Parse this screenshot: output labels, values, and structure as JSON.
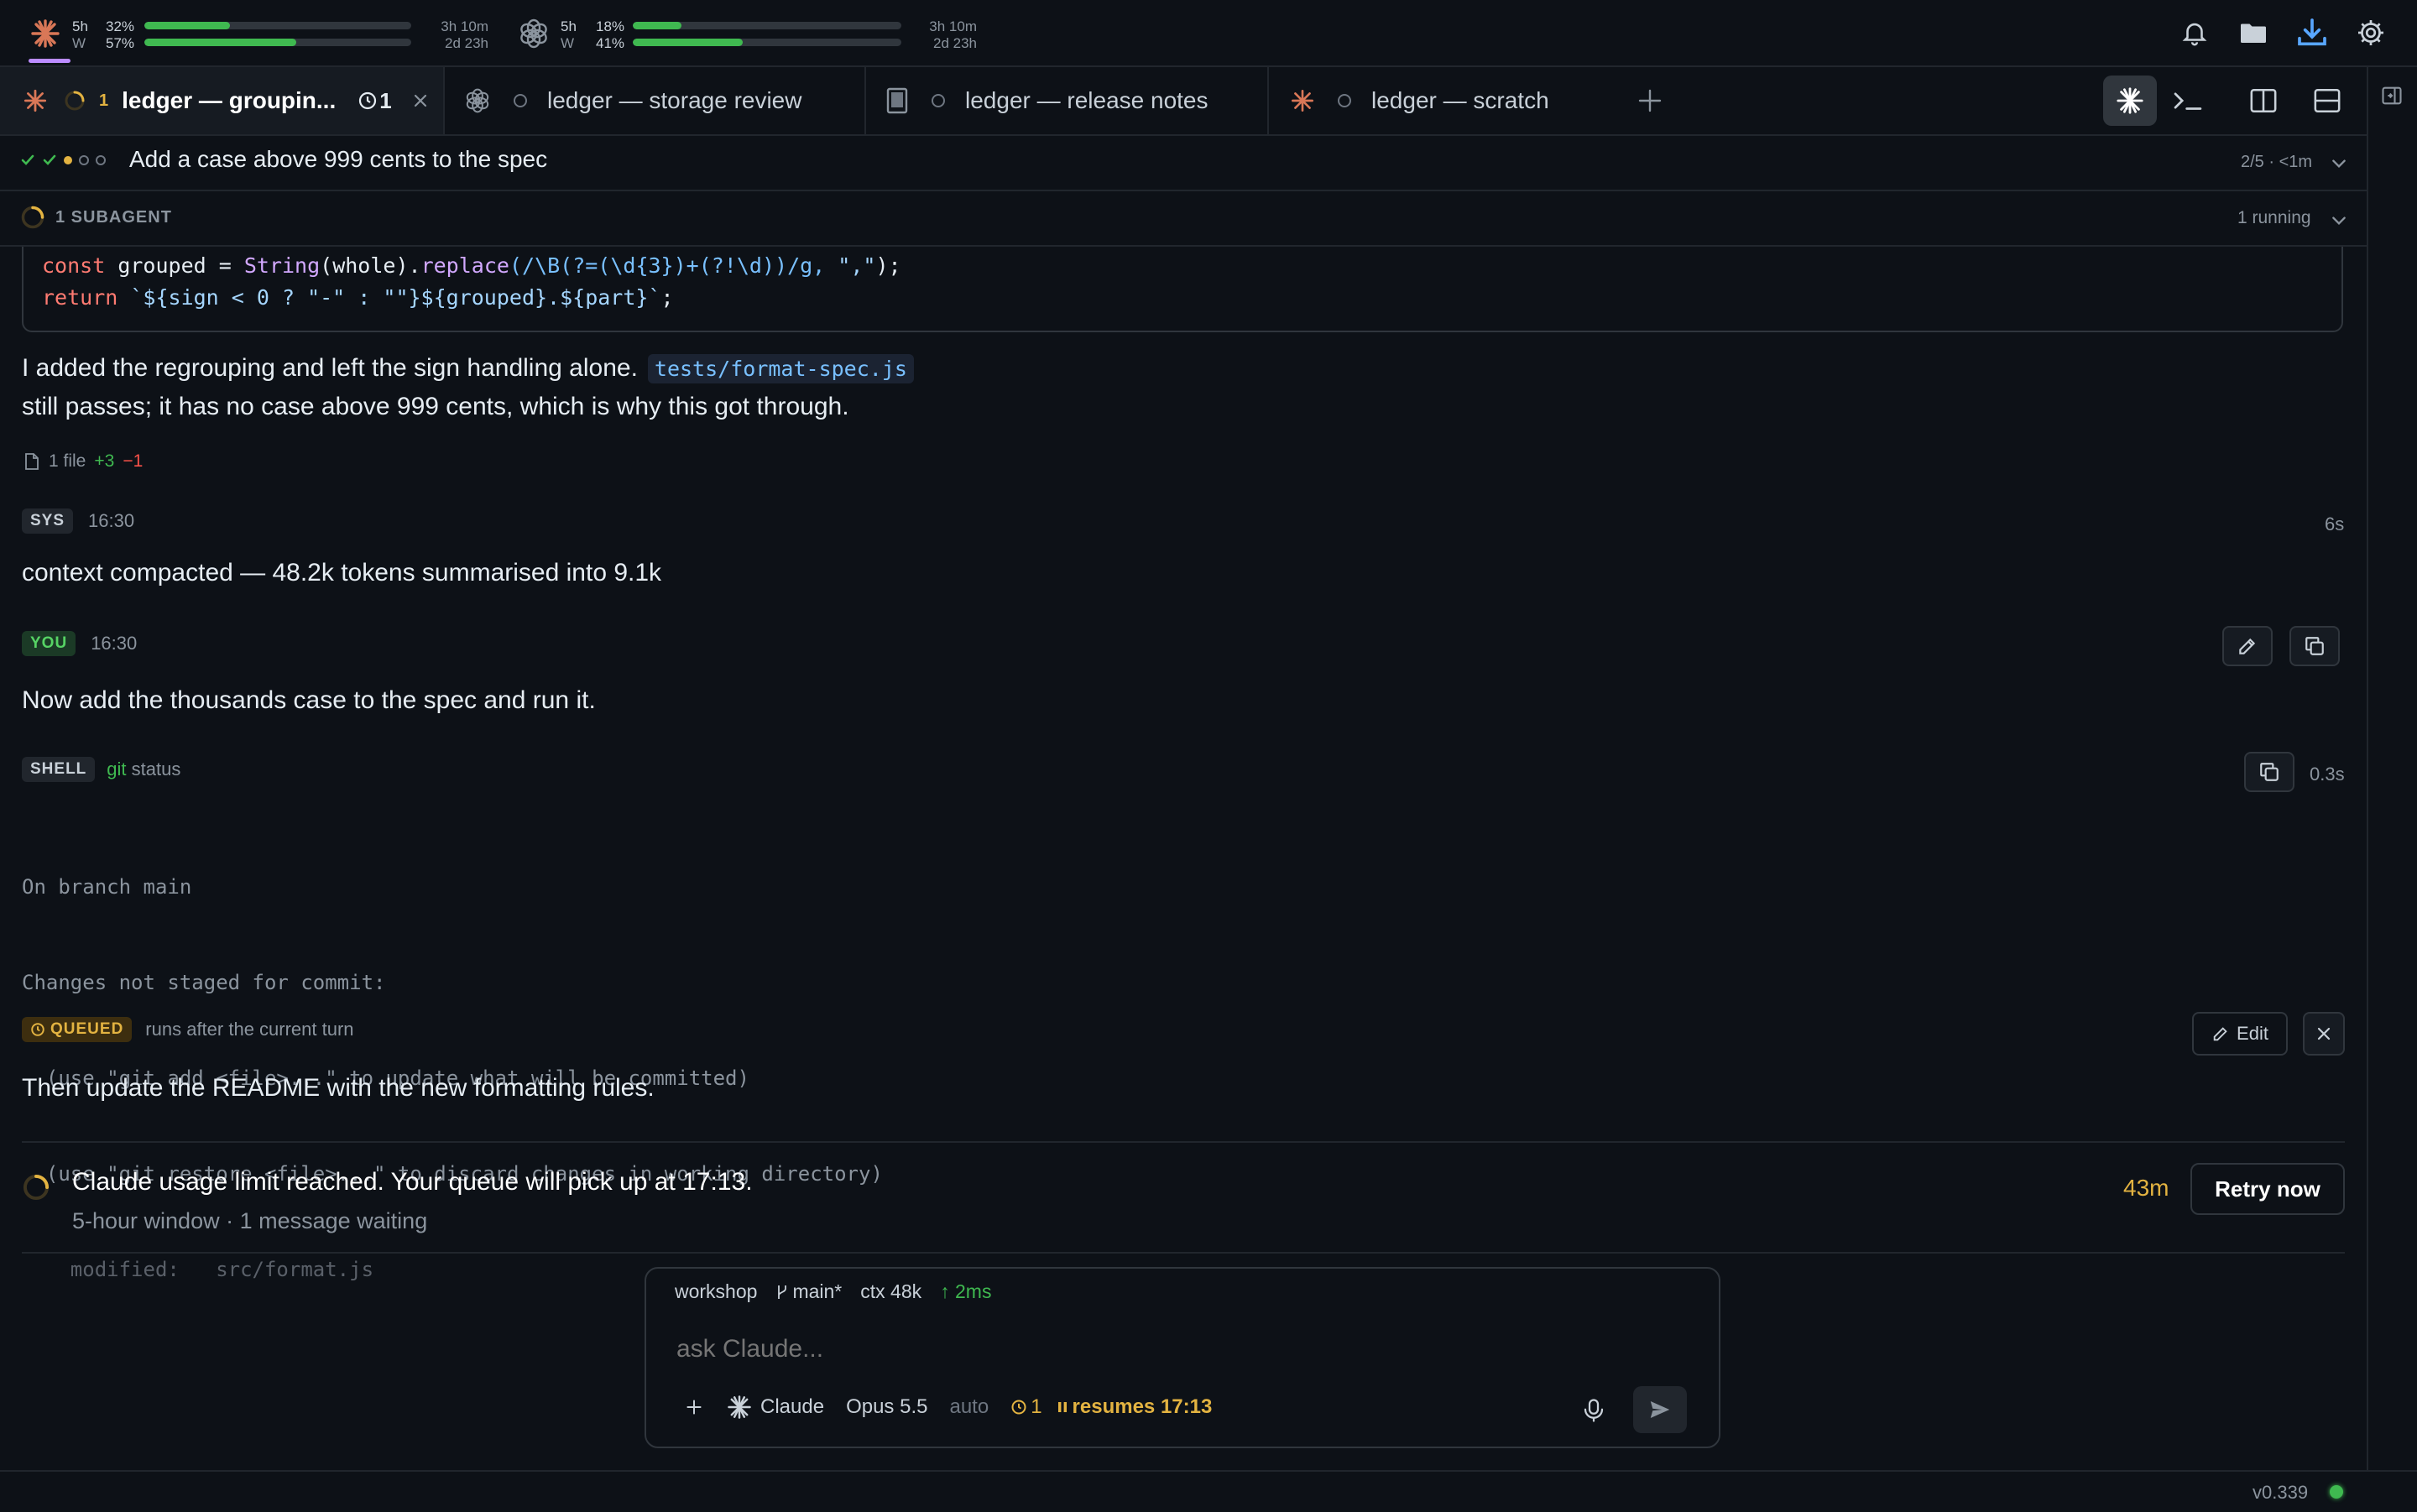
{
  "usage": [
    {
      "logo": "claude-logo",
      "row1_label": "5h",
      "row2_label": "W",
      "row1_pct": "32%",
      "row2_pct": "57%",
      "row1_fill": 0.32,
      "row2_fill": 0.57,
      "row1_time": "3h 10m",
      "row2_time": "2d 23h"
    },
    {
      "logo": "openai-logo",
      "row1_label": "5h",
      "row2_label": "W",
      "row1_pct": "18%",
      "row2_pct": "41%",
      "row1_fill": 0.18,
      "row2_fill": 0.41,
      "row1_time": "3h 10m",
      "row2_time": "2d 23h"
    }
  ],
  "top_icons": [
    "bell-icon",
    "folder-icon",
    "download-icon",
    "gear-icon"
  ],
  "tabs": [
    {
      "label": "ledger — groupin...",
      "badge": "1",
      "queue_count": "1",
      "active": true
    },
    {
      "label": "ledger — storage review"
    },
    {
      "label": "ledger — release notes"
    },
    {
      "label": "ledger — scratch"
    }
  ],
  "task": {
    "title": "Add a case above 999 cents to the spec",
    "progress": "2/5 · <1m"
  },
  "subagent": {
    "label": "1 SUBAGENT",
    "status": "1 running"
  },
  "code_lines": {
    "l1_kw": "const",
    "l1_a": " grouped = ",
    "l1_fn1": "String",
    "l1_b": "(whole).",
    "l1_fn2": "replace",
    "l1_c": "(/\\B(?=(\\d{3})+(?!\\d))/g, ",
    "l1_str": "\",\"",
    "l1_d": ");",
    "l2_kw": "return",
    "l2_str": " `${sign < 0 ? \"-\" : \"\"}${grouped}.${part}`",
    "l2_d": ";"
  },
  "assistant": {
    "line1_a": "I added the regrouping and left the sign handling alone.",
    "line1_code": "tests/format-spec.js",
    "line2": "still passes; it has no case above 999 cents, which is why this got through.",
    "files": "1 file",
    "added": "+3",
    "removed": "−1"
  },
  "sys": {
    "tag": "SYS",
    "time": "16:30",
    "duration": "6s",
    "text": "context compacted — 48.2k tokens summarised into 9.1k"
  },
  "you": {
    "tag": "YOU",
    "time": "16:30",
    "text": "Now add the thousands case to the spec and run it."
  },
  "shell": {
    "tag": "SHELL",
    "cmd": "git",
    "args": "status",
    "duration": "0.3s",
    "output": [
      "On branch main",
      "Changes not staged for commit:",
      "  (use \"git add <file>...\" to update what will be committed)",
      "  (use \"git restore <file>...\" to discard changes in working directory)",
      "    modified:   src/format.js"
    ]
  },
  "queued": {
    "tag": "QUEUED",
    "note": "runs after the current turn",
    "edit_label": "Edit",
    "text": "Then update the README with the new formatting rules."
  },
  "limit": {
    "title": "Claude usage limit reached. Your queue will pick up at 17:13.",
    "subtitle": "5-hour window · 1 message waiting",
    "countdown": "43m",
    "retry_label": "Retry now"
  },
  "composer": {
    "workspace": "workshop",
    "branch": "main*",
    "ctx": "ctx 48k",
    "latency": "↑ 2ms",
    "placeholder": "ask Claude...",
    "agent": "Claude",
    "model": "Opus 5.5",
    "mode": "auto",
    "queue_count": "1",
    "resumes": "resumes 17:13"
  },
  "version": "v0.339",
  "colors": {
    "accent": "#bc8cff",
    "claude": "#d97757",
    "ok": "#3fb950",
    "warn": "#e3b341"
  }
}
